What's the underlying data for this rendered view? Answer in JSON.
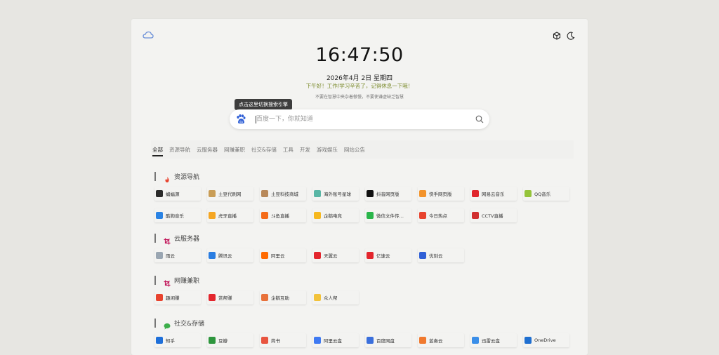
{
  "clock": "16:47:50",
  "date": "2026年4月  2日  星期四",
  "greeting": "下午好！工作/学习辛苦了，记得休息一下哦！",
  "motto": "不要在智慧中夹杂着傲慢，不要使谦虚缺乏智慧",
  "tooltip": "点击这里切换搜索引擎",
  "search": {
    "placeholder": "百度一下，你就知道"
  },
  "tabs": [
    "全部",
    "资源导航",
    "云服务器",
    "网赚兼职",
    "社交&存储",
    "工具",
    "开发",
    "游戏娱乐",
    "网站公告"
  ],
  "sections": [
    {
      "title": "资源导航",
      "icon": "fire-icon",
      "color": "#e8432e",
      "items": [
        {
          "label": "蝙蝠源",
          "color": "#2b2b2b"
        },
        {
          "label": "土豆代刷网",
          "color": "#c99d56"
        },
        {
          "label": "土豆科技商城",
          "color": "#b8895a"
        },
        {
          "label": "海外账号星球",
          "color": "#59b6a5"
        },
        {
          "label": "抖音网页版",
          "color": "#111111"
        },
        {
          "label": "快手网页版",
          "color": "#f3932b"
        },
        {
          "label": "网易云音乐",
          "color": "#e0262d"
        },
        {
          "label": "QQ音乐",
          "color": "#95c43a"
        },
        {
          "label": "酷狗音乐",
          "color": "#2a83e4"
        },
        {
          "label": "虎牙直播",
          "color": "#f5a623"
        },
        {
          "label": "斗鱼直播",
          "color": "#f56b18"
        },
        {
          "label": "企鹅电竞",
          "color": "#f6b81f"
        },
        {
          "label": "微信文件传…",
          "color": "#2ab54a"
        },
        {
          "label": "今日热点",
          "color": "#e8432e"
        },
        {
          "label": "CCTV直播",
          "color": "#d12f2f"
        }
      ]
    },
    {
      "title": "云服务器",
      "icon": "crop-icon",
      "color": "#c2185b",
      "items": [
        {
          "label": "雨云",
          "color": "#9aa6b2"
        },
        {
          "label": "腾讯云",
          "color": "#2a7de1"
        },
        {
          "label": "阿里云",
          "color": "#ff6a00"
        },
        {
          "label": "天翼云",
          "color": "#e3262d"
        },
        {
          "label": "亿速云",
          "color": "#e3262d"
        },
        {
          "label": "优刻云",
          "color": "#2f5fd6"
        }
      ]
    },
    {
      "title": "网赚兼职",
      "icon": "crop-icon",
      "color": "#c2185b",
      "items": [
        {
          "label": "趣闲赚",
          "color": "#e8432e"
        },
        {
          "label": "赏帮赚",
          "color": "#e3262d"
        },
        {
          "label": "企鹅互助",
          "color": "#e8713a"
        },
        {
          "label": "众人帮",
          "color": "#f2c23a"
        }
      ]
    },
    {
      "title": "社交&存储",
      "icon": "chat-icon",
      "color": "#3cae4a",
      "items": [
        {
          "label": "知乎",
          "color": "#1e6fd9"
        },
        {
          "label": "豆瓣",
          "color": "#2e963d"
        },
        {
          "label": "简书",
          "color": "#e8543f"
        },
        {
          "label": "阿里云盘",
          "color": "#3f7af2"
        },
        {
          "label": "百度网盘",
          "color": "#3a6fdc"
        },
        {
          "label": "蓝奏云",
          "color": "#f0792e"
        },
        {
          "label": "迅雷云盘",
          "color": "#3a8ee8"
        },
        {
          "label": "OneDrive",
          "color": "#1f6fd0"
        }
      ]
    }
  ]
}
